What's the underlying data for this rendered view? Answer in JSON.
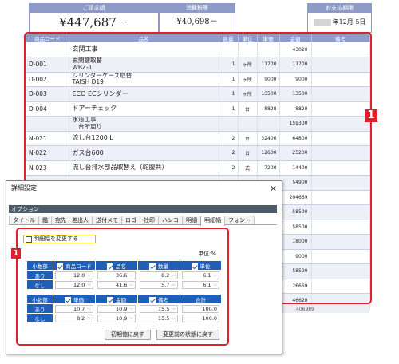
{
  "header": {
    "total_label": "ご請求額",
    "total_value": "¥447,687－",
    "tax_label": "消費税等",
    "tax_value": "¥40,698－",
    "due_label": "お支払期限",
    "due_value": "年12月 5日"
  },
  "table": {
    "columns": [
      "商品コード",
      "品名",
      "数量",
      "単位",
      "単価",
      "金額",
      "備考"
    ],
    "rows": [
      {
        "code": "",
        "name": [
          "玄関工事"
        ],
        "qty": "",
        "unit": "",
        "price": "",
        "amount": "43020"
      },
      {
        "code": "D-001",
        "name": [
          "玄関鍵取替",
          "WBZ-1"
        ],
        "qty": "1",
        "unit": "ヶ所",
        "price": "11700",
        "amount": "11700"
      },
      {
        "code": "D-002",
        "name": [
          "シリンダーケース取替",
          "TAISH D19"
        ],
        "qty": "1",
        "unit": "ヶ所",
        "price": "9000",
        "amount": "9000"
      },
      {
        "code": "D-003",
        "name": [
          "ECO ECシリンダー"
        ],
        "qty": "1",
        "unit": "ヶ所",
        "price": "13500",
        "amount": "13500"
      },
      {
        "code": "D-004",
        "name": [
          "ドアーチェック"
        ],
        "qty": "1",
        "unit": "台",
        "price": "8820",
        "amount": "8820"
      },
      {
        "code": "",
        "name": [
          "水道工事",
          "　台所周り"
        ],
        "qty": "",
        "unit": "",
        "price": "",
        "amount": "159300"
      },
      {
        "code": "N-021",
        "name": [
          "流し台1200 L"
        ],
        "qty": "2",
        "unit": "台",
        "price": "32400",
        "amount": "64800"
      },
      {
        "code": "N-022",
        "name": [
          "ガス台600"
        ],
        "qty": "2",
        "unit": "台",
        "price": "12600",
        "amount": "25200"
      },
      {
        "code": "N-023",
        "name": [
          "流し台排水部品取替え（蛇腹共）"
        ],
        "qty": "2",
        "unit": "式",
        "price": "7200",
        "amount": "14400"
      },
      {
        "code": "",
        "name": [
          ""
        ],
        "qty": "",
        "unit": "",
        "price": "",
        "amount": "54900"
      },
      {
        "code": "",
        "name": [
          ""
        ],
        "qty": "",
        "unit": "",
        "price": "",
        "amount": "204669"
      },
      {
        "code": "",
        "name": [
          ""
        ],
        "qty": "",
        "unit": "",
        "price": "",
        "amount": "58500"
      },
      {
        "code": "",
        "name": [
          ""
        ],
        "qty": "",
        "unit": "",
        "price": "",
        "amount": "58500"
      },
      {
        "code": "",
        "name": [
          ""
        ],
        "qty": "",
        "unit": "",
        "price": "",
        "amount": "18000"
      },
      {
        "code": "",
        "name": [
          ""
        ],
        "qty": "",
        "unit": "",
        "price": "",
        "amount": "9000"
      },
      {
        "code": "",
        "name": [
          ""
        ],
        "qty": "",
        "unit": "",
        "price": "",
        "amount": "58500"
      },
      {
        "code": "",
        "name": [
          ""
        ],
        "qty": "",
        "unit": "",
        "price": "",
        "amount": "26669"
      },
      {
        "code": "",
        "name": [
          ""
        ],
        "qty": "",
        "unit": "",
        "price": "",
        "amount": "46620"
      }
    ],
    "footer_amount": "406989"
  },
  "badge_main": "1",
  "dialog": {
    "title": "詳細設定",
    "close": "✕",
    "section": "オプション",
    "tabs": [
      "タイトル",
      "鑑",
      "宛先・差出人",
      "送付メモ",
      "ロゴ",
      "社印",
      "ハンコ",
      "明細",
      "明細幅",
      "フォント"
    ],
    "active_tab": "明細幅",
    "checkbox_label": "明細幅を変更する",
    "checkbox_checked": false,
    "unit_note": "単位:%",
    "badge": "1",
    "grid1": {
      "corner": "小数部",
      "headers": [
        "商品コード",
        "品名",
        "数量",
        "単位"
      ],
      "rows": [
        {
          "label": "あり",
          "values": [
            "12.0",
            "36.6",
            "8.2",
            "6.1"
          ]
        },
        {
          "label": "なし",
          "values": [
            "12.0",
            "41.6",
            "5.7",
            "6.1"
          ]
        }
      ]
    },
    "grid2": {
      "corner": "小数部",
      "headers": [
        "単価",
        "金額",
        "備考",
        "合計"
      ],
      "rows": [
        {
          "label": "あり",
          "values": [
            "10.7",
            "10.9",
            "15.5",
            "100.0"
          ]
        },
        {
          "label": "なし",
          "values": [
            "8.2",
            "10.9",
            "15.5",
            "100.0"
          ]
        }
      ]
    },
    "btn_reset": "初期値に戻す",
    "btn_restore": "変更前の状態に戻す"
  },
  "colors": {
    "accent_red": "#e0202c",
    "header_blue": "#1f5fb8",
    "table_header": "#8e9bc8"
  }
}
